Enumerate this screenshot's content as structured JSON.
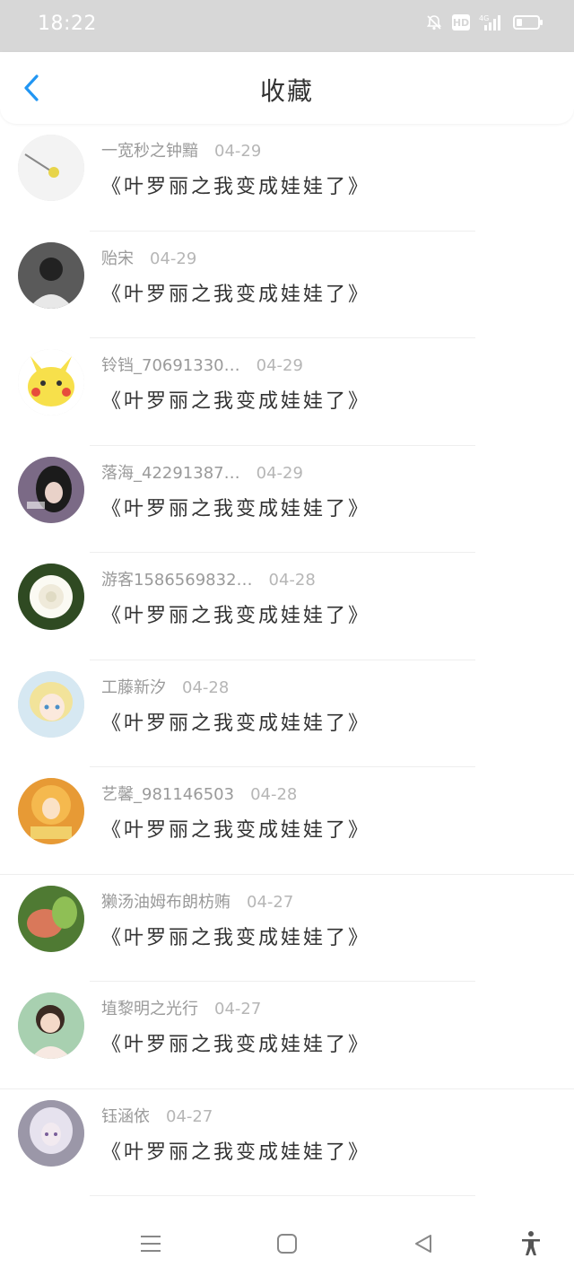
{
  "status_bar": {
    "time": "18:22",
    "hd_label": "HD",
    "network_label": "4G"
  },
  "header": {
    "title": "收藏"
  },
  "items": [
    {
      "user": "一宽秒之钟黯",
      "date": "04-29",
      "book": "《叶罗丽之我变成娃娃了》",
      "avatar_color": "#f3f3f3"
    },
    {
      "user": "贻宋",
      "date": "04-29",
      "book": "《叶罗丽之我变成娃娃了》",
      "avatar_color": "#555555"
    },
    {
      "user": "铃铛_70691330…",
      "date": "04-29",
      "book": "《叶罗丽之我变成娃娃了》",
      "avatar_color": "#f7e04b"
    },
    {
      "user": "落海_42291387…",
      "date": "04-29",
      "book": "《叶罗丽之我变成娃娃了》",
      "avatar_color": "#6c5a7a"
    },
    {
      "user": "游客1586569832…",
      "date": "04-28",
      "book": "《叶罗丽之我变成娃娃了》",
      "avatar_color": "#3d5a2a"
    },
    {
      "user": "工藤新汐",
      "date": "04-28",
      "book": "《叶罗丽之我变成娃娃了》",
      "avatar_color": "#cfe3ef"
    },
    {
      "user": "艺馨_981146503",
      "date": "04-28",
      "book": "《叶罗丽之我变成娃娃了》",
      "avatar_color": "#e8a23a"
    },
    {
      "user": "獭汤油姆布朗枋贿",
      "date": "04-27",
      "book": "《叶罗丽之我变成娃娃了》",
      "avatar_color": "#5f8a3a"
    },
    {
      "user": "埴黎明之光行",
      "date": "04-27",
      "book": "《叶罗丽之我变成娃娃了》",
      "avatar_color": "#9fc4a8"
    },
    {
      "user": "钰涵依",
      "date": "04-27",
      "book": "《叶罗丽之我变成娃娃了》",
      "avatar_color": "#8a8a9a"
    }
  ],
  "colors": {
    "accent": "#2196f3",
    "status_bar_bg": "#d7d7d7"
  }
}
